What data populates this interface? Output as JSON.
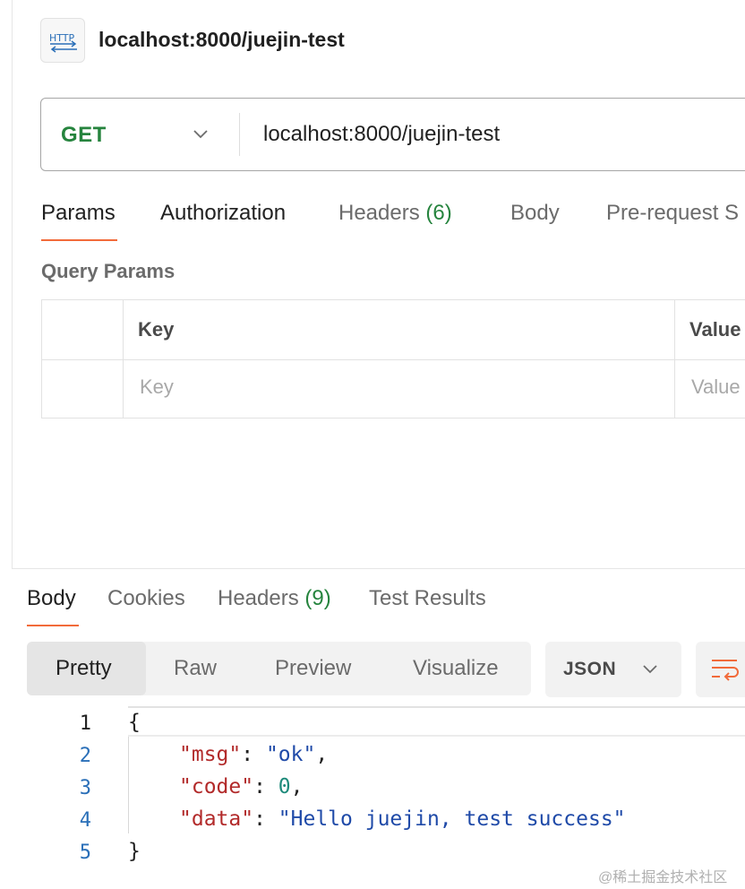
{
  "header": {
    "title": "localhost:8000/juejin-test",
    "icon": "http-request-icon"
  },
  "url_bar": {
    "method": "GET",
    "url": "localhost:8000/juejin-test"
  },
  "request_tabs": [
    {
      "label": "Params",
      "active": true
    },
    {
      "label": "Authorization"
    },
    {
      "label": "Headers",
      "count": "(6)"
    },
    {
      "label": "Body"
    },
    {
      "label": "Pre-request S"
    }
  ],
  "query_params": {
    "label": "Query Params",
    "columns": [
      "Key",
      "Value"
    ],
    "placeholders": [
      "Key",
      "Value"
    ]
  },
  "response_tabs": [
    {
      "label": "Body",
      "active": true
    },
    {
      "label": "Cookies"
    },
    {
      "label": "Headers",
      "count": "(9)"
    },
    {
      "label": "Test Results"
    }
  ],
  "format_tabs": [
    {
      "label": "Pretty",
      "active": true
    },
    {
      "label": "Raw"
    },
    {
      "label": "Preview"
    },
    {
      "label": "Visualize"
    }
  ],
  "format_select": "JSON",
  "code": {
    "line_numbers": [
      "1",
      "2",
      "3",
      "4",
      "5"
    ],
    "open_brace": "{",
    "close_brace": "}",
    "entries": [
      {
        "key": "\"msg\"",
        "value": "\"ok\"",
        "value_type": "string",
        "trail": ","
      },
      {
        "key": "\"code\"",
        "value": "0",
        "value_type": "number",
        "trail": ","
      },
      {
        "key": "\"data\"",
        "value": "\"Hello juejin, test success\"",
        "value_type": "string",
        "trail": ""
      }
    ],
    "colon": ": "
  },
  "watermark": "@稀土掘金技术社区",
  "colors": {
    "accent": "#f26b3a",
    "method_get": "#26843e",
    "json_key": "#b22a2a",
    "json_string": "#1f4aa8",
    "json_number": "#1d8a7a"
  }
}
